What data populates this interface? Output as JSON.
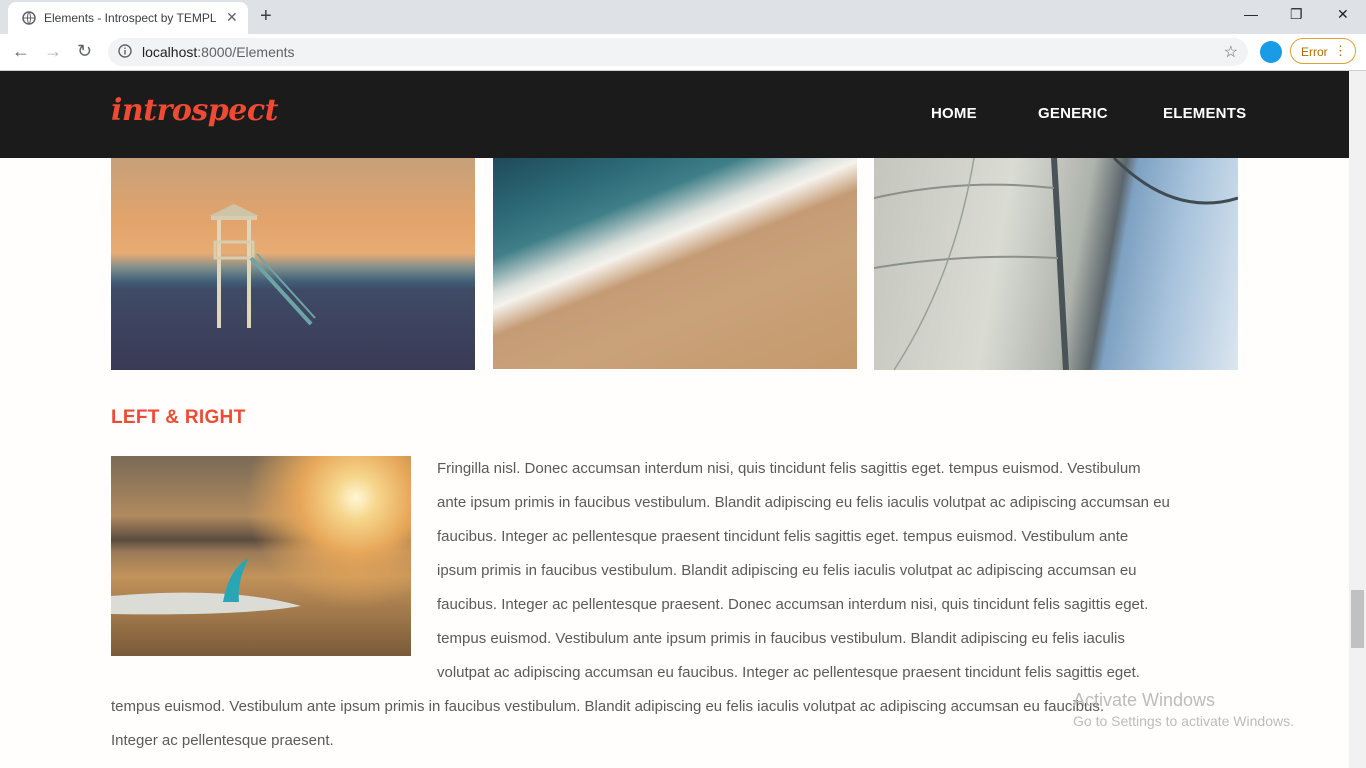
{
  "browser": {
    "tab_title": "Elements - Introspect by TEMPLA",
    "tab_close": "✕",
    "new_tab": "+",
    "url_host": "localhost",
    "url_path": ":8000/Elements",
    "error_label": "Error",
    "window_controls": [
      "—",
      "❐",
      "✕"
    ]
  },
  "site": {
    "logo": "introspect",
    "nav": [
      "HOME",
      "GENERIC",
      "ELEMENTS"
    ]
  },
  "section": {
    "title": "LEFT & RIGHT",
    "paragraph_right_lines": [
      "Fringilla nisl. Donec accumsan interdum nisi, quis tincidunt felis sagittis eget. tempus euismod. Vestibulum",
      "ante ipsum primis in faucibus vestibulum. Blandit adipiscing eu felis iaculis volutpat ac adipiscing accumsan eu",
      "faucibus. Integer ac pellentesque praesent tincidunt felis sagittis eget. tempus euismod. Vestibulum ante",
      "ipsum primis in faucibus vestibulum. Blandit adipiscing eu felis iaculis volutpat ac adipiscing accumsan eu",
      "faucibus. Integer ac pellentesque praesent. Donec accumsan interdum nisi, quis tincidunt felis sagittis eget.",
      "tempus euismod. Vestibulum ante ipsum primis in faucibus vestibulum. Blandit adipiscing eu felis iaculis",
      "volutpat ac adipiscing accumsan eu faucibus. Integer ac pellentesque praesent tincidunt felis sagittis eget."
    ],
    "paragraph_left_lines": [
      "tempus euismod. Vestibulum ante ipsum primis in faucibus vestibulum. Blandit adipiscing eu felis iaculis volutpat ac adipiscing accumsan eu faucibus.",
      "Integer ac pellentesque praesent."
    ]
  },
  "watermark": {
    "line1": "Activate Windows",
    "line2": "Go to Settings to activate Windows."
  }
}
